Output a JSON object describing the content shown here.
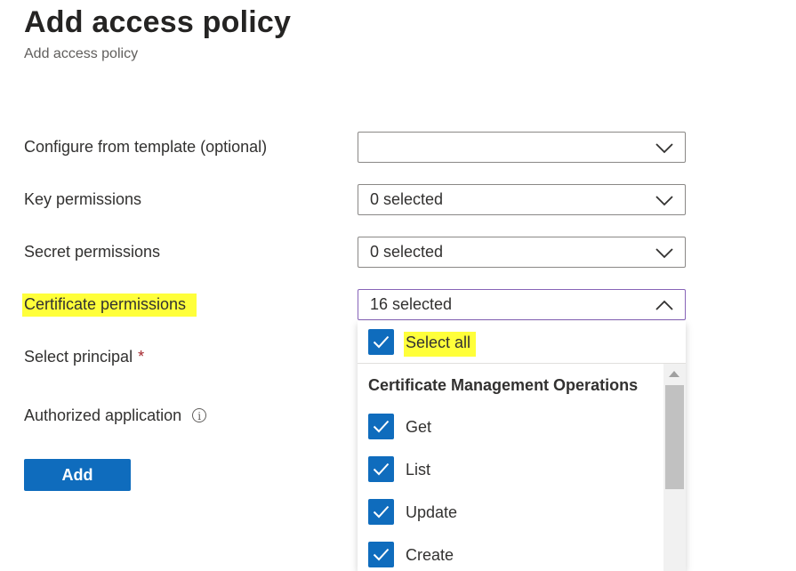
{
  "header": {
    "title": "Add access policy",
    "subtitle": "Add access policy"
  },
  "form": {
    "template_label": "Configure from template (optional)",
    "template_value": "",
    "key_label": "Key permissions",
    "key_value": "0 selected",
    "secret_label": "Secret permissions",
    "secret_value": "0 selected",
    "certificate_label": "Certificate permissions",
    "certificate_value": "16 selected",
    "principal_label": "Select principal",
    "principal_required_mark": "*",
    "app_label": "Authorized application",
    "info_glyph": "i",
    "add_label": "Add"
  },
  "certificate_dropdown": {
    "select_all_label": "Select all",
    "select_all_checked": true,
    "group_header": "Certificate Management Operations",
    "options": [
      {
        "label": "Get",
        "checked": true
      },
      {
        "label": "List",
        "checked": true
      },
      {
        "label": "Update",
        "checked": true
      },
      {
        "label": "Create",
        "checked": true
      }
    ]
  },
  "colors": {
    "accent": "#0f6cbd",
    "highlight": "#ffff3a",
    "open_border": "#8764b8",
    "required": "#a4262c"
  },
  "icons": [
    "chevron-down-icon",
    "chevron-up-icon",
    "checkmark-icon",
    "info-icon",
    "scroll-up-arrow-icon"
  ]
}
